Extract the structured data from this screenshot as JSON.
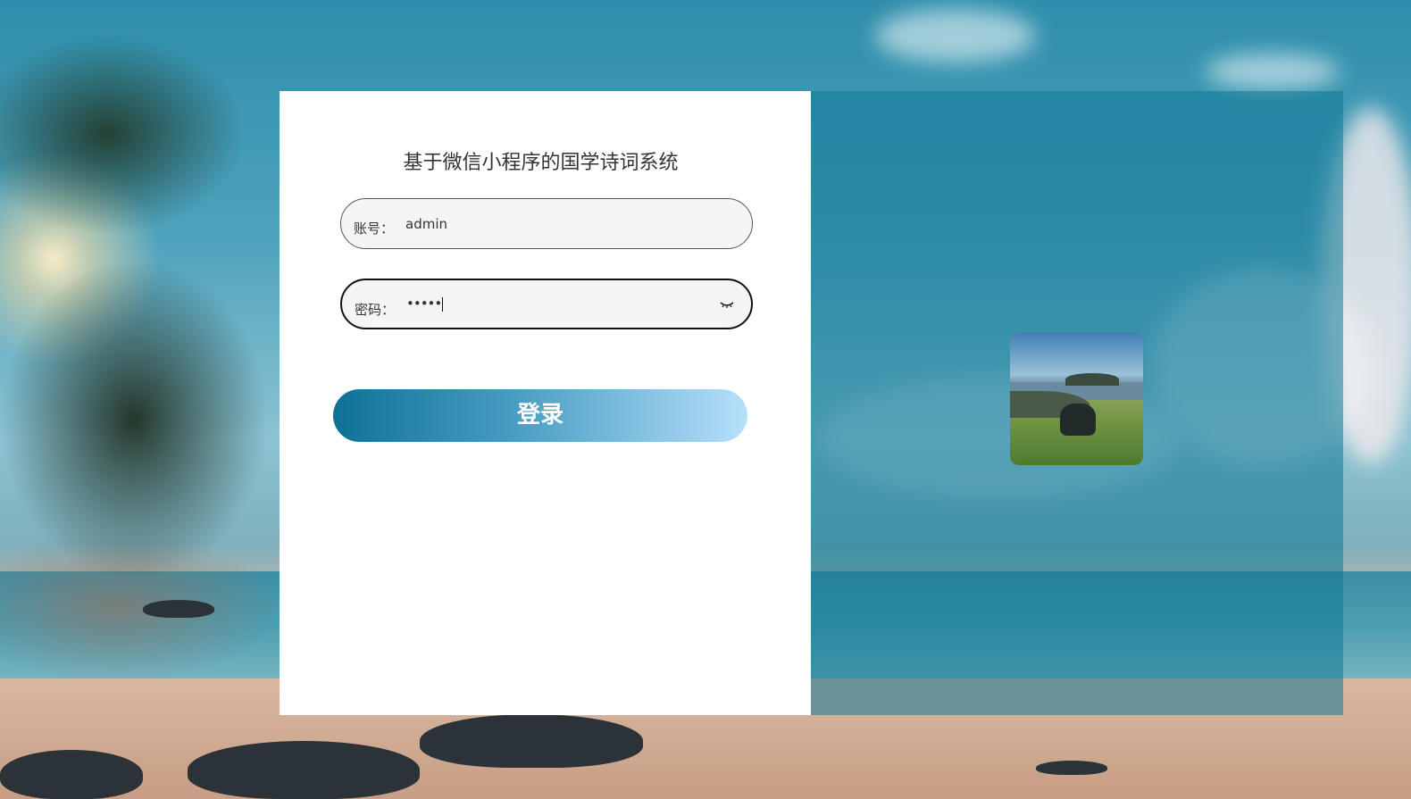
{
  "app": {
    "title": "基于微信小程序的国学诗词系统"
  },
  "form": {
    "account": {
      "label": "账号：",
      "value": "admin"
    },
    "password": {
      "label": "密码：",
      "value": "•••••"
    },
    "login_label": "登录"
  },
  "icons": {
    "password_toggle": "eye-closed-icon"
  },
  "colors": {
    "button_start": "#0f7197",
    "button_end": "#b6e0fb",
    "right_panel_tint": "#1078960"
  }
}
